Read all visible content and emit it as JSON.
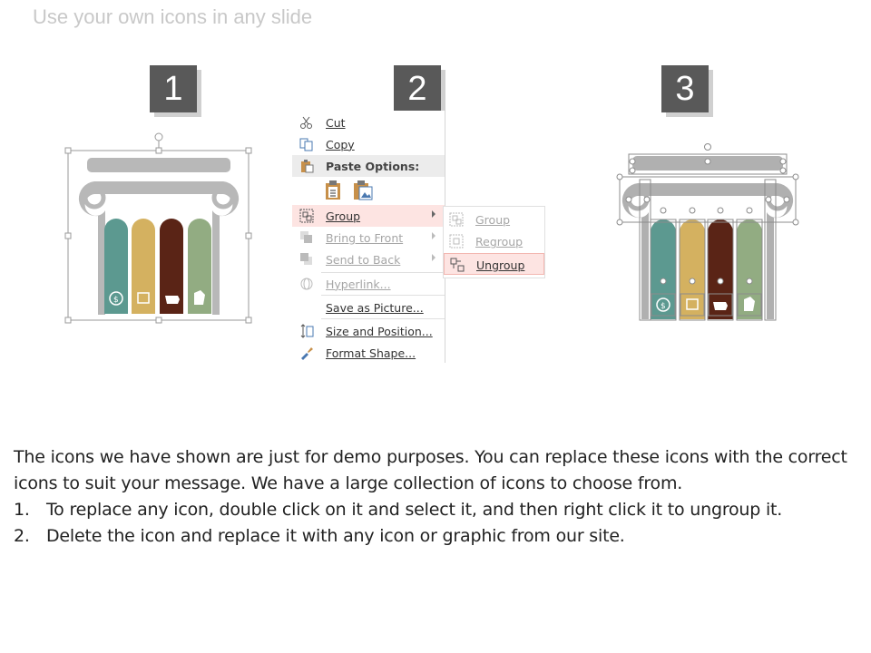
{
  "slide": {
    "title": "Use your own icons in any slide"
  },
  "steps": [
    {
      "label": "1"
    },
    {
      "label": "2"
    },
    {
      "label": "3"
    }
  ],
  "pillar": {
    "column_colors": [
      "#5c9990",
      "#d4b160",
      "#5a2416",
      "#92ac82"
    ],
    "capital_color": "#b8b8b8",
    "column_icons": [
      "dollar-coin-icon",
      "certificate-icon",
      "piggy-bank-icon",
      "money-bag-icon"
    ]
  },
  "context_menu": {
    "items": [
      {
        "label": "Cut",
        "icon": "scissors-icon",
        "disabled": false
      },
      {
        "label": "Copy",
        "icon": "copy-icon",
        "disabled": false
      },
      {
        "label": "Paste Options:",
        "icon": "clipboard-icon",
        "header": true
      },
      {
        "label": "Group",
        "icon": "group-icon",
        "disabled": false,
        "highlighted": true,
        "submenu": true
      },
      {
        "label": "Bring to Front",
        "icon": "bring-front-icon",
        "disabled": true,
        "submenu": true
      },
      {
        "label": "Send to Back",
        "icon": "send-back-icon",
        "disabled": true,
        "submenu": true
      },
      {
        "label": "Hyperlink...",
        "icon": "link-icon",
        "disabled": true
      },
      {
        "label": "Save as Picture...",
        "icon": "",
        "disabled": false
      },
      {
        "label": "Size and Position...",
        "icon": "size-position-icon",
        "disabled": false
      },
      {
        "label": "Format Shape...",
        "icon": "format-shape-icon",
        "disabled": false
      }
    ],
    "submenu": [
      {
        "label": "Group",
        "disabled": true
      },
      {
        "label": "Regroup",
        "disabled": true
      },
      {
        "label": "Ungroup",
        "disabled": false,
        "highlighted": true
      }
    ],
    "highlight_color": "#fde4e2"
  },
  "description": {
    "intro": "The icons we have shown are just for demo purposes. You can replace these icons with the correct icons to suit your message. We have a large collection of icons to choose from.",
    "steps": [
      {
        "num": "1.",
        "text": "To replace any icon, double click on it and select it, and then right click it to ungroup it."
      },
      {
        "num": "2.",
        "text": "Delete the icon and replace it with any icon or graphic from our site."
      }
    ]
  }
}
